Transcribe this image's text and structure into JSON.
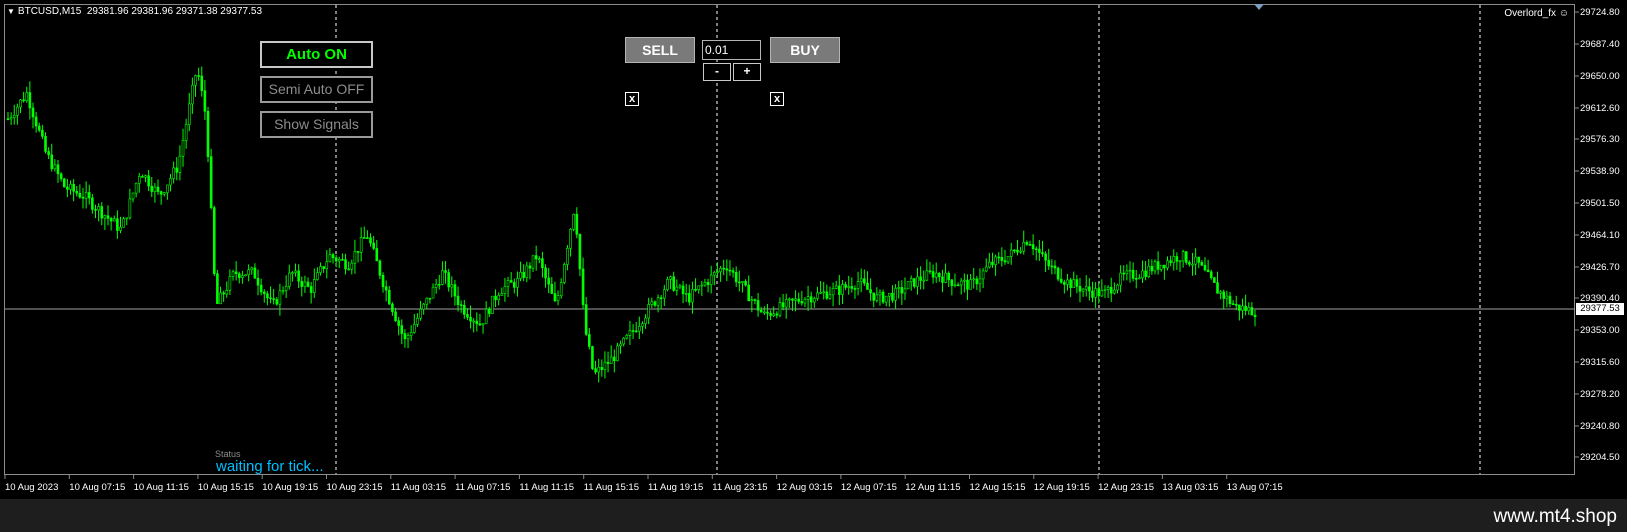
{
  "header": {
    "symbol": "BTCUSD,M15",
    "ohlc": "29381.96 29381.96 29371.38 29377.53",
    "indicator": "Overlord_fx"
  },
  "panel": {
    "auto_label": "Auto ON",
    "semi_label": "Semi Auto OFF",
    "signals_label": "Show Signals"
  },
  "trade": {
    "sell_label": "SELL",
    "buy_label": "BUY",
    "lot_value": "0.01",
    "minus_label": "-",
    "plus_label": "+",
    "close_sell_label": "x",
    "close_buy_label": "x"
  },
  "status": {
    "label": "Status",
    "text": "waiting for tick..."
  },
  "current_price": "29377.53",
  "footer": {
    "site": "www.mt4.shop"
  },
  "colors": {
    "candle": "#00ff00",
    "background": "#000000",
    "grid": "#ffffff",
    "status_text": "#00bfff"
  },
  "chart_data": {
    "type": "candlestick",
    "price_axis": [
      "29724.80",
      "29687.40",
      "29650.00",
      "29612.60",
      "29576.30",
      "29538.90",
      "29501.50",
      "29464.10",
      "29426.70",
      "29390.40",
      "29353.00",
      "29315.60",
      "29278.20",
      "29240.80",
      "29204.50"
    ],
    "time_axis": [
      "10 Aug 2023",
      "10 Aug 07:15",
      "10 Aug 11:15",
      "10 Aug 15:15",
      "10 Aug 19:15",
      "10 Aug 23:15",
      "11 Aug 03:15",
      "11 Aug 07:15",
      "11 Aug 11:15",
      "11 Aug 15:15",
      "11 Aug 19:15",
      "11 Aug 23:15",
      "12 Aug 03:15",
      "12 Aug 07:15",
      "12 Aug 11:15",
      "12 Aug 15:15",
      "12 Aug 19:15",
      "12 Aug 23:15",
      "13 Aug 03:15",
      "13 Aug 07:15"
    ],
    "ylim": [
      29204.5,
      29724.8
    ],
    "path_points": [
      [
        0,
        29600
      ],
      [
        8,
        29630
      ],
      [
        16,
        29560
      ],
      [
        24,
        29520
      ],
      [
        32,
        29510
      ],
      [
        40,
        29490
      ],
      [
        48,
        29470
      ],
      [
        56,
        29540
      ],
      [
        64,
        29510
      ],
      [
        72,
        29545
      ],
      [
        80,
        29660
      ],
      [
        84,
        29600
      ],
      [
        88,
        29380
      ],
      [
        96,
        29420
      ],
      [
        104,
        29420
      ],
      [
        112,
        29380
      ],
      [
        120,
        29420
      ],
      [
        128,
        29400
      ],
      [
        136,
        29440
      ],
      [
        144,
        29430
      ],
      [
        152,
        29465
      ],
      [
        160,
        29400
      ],
      [
        168,
        29340
      ],
      [
        176,
        29380
      ],
      [
        184,
        29420
      ],
      [
        192,
        29380
      ],
      [
        200,
        29360
      ],
      [
        208,
        29400
      ],
      [
        216,
        29410
      ],
      [
        224,
        29440
      ],
      [
        232,
        29380
      ],
      [
        240,
        29500
      ],
      [
        244,
        29360
      ],
      [
        248,
        29300
      ],
      [
        256,
        29320
      ],
      [
        264,
        29350
      ],
      [
        272,
        29380
      ],
      [
        280,
        29410
      ],
      [
        288,
        29390
      ],
      [
        296,
        29410
      ],
      [
        304,
        29430
      ],
      [
        312,
        29400
      ],
      [
        320,
        29370
      ],
      [
        328,
        29380
      ],
      [
        336,
        29390
      ],
      [
        344,
        29395
      ],
      [
        352,
        29400
      ],
      [
        360,
        29410
      ],
      [
        368,
        29390
      ],
      [
        376,
        29395
      ],
      [
        384,
        29410
      ],
      [
        392,
        29420
      ],
      [
        400,
        29410
      ],
      [
        408,
        29405
      ],
      [
        416,
        29430
      ],
      [
        424,
        29440
      ],
      [
        432,
        29460
      ],
      [
        440,
        29430
      ],
      [
        448,
        29410
      ],
      [
        456,
        29400
      ],
      [
        464,
        29395
      ],
      [
        472,
        29415
      ],
      [
        480,
        29420
      ],
      [
        488,
        29430
      ],
      [
        496,
        29440
      ],
      [
        504,
        29430
      ],
      [
        512,
        29400
      ],
      [
        520,
        29380
      ],
      [
        528,
        29375
      ]
    ]
  }
}
